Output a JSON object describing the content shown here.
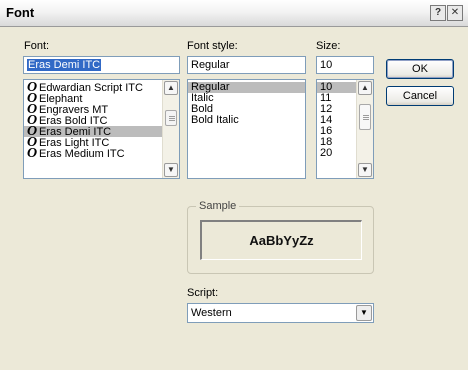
{
  "window": {
    "title": "Font",
    "help_glyph": "?",
    "close_glyph": "✕"
  },
  "font": {
    "label": "Font:",
    "value": "Eras Demi ITC",
    "items": [
      {
        "glyph": "O",
        "label": "Edwardian Script ITC"
      },
      {
        "glyph": "O",
        "label": "Elephant"
      },
      {
        "glyph": "O",
        "label": "Engravers MT"
      },
      {
        "glyph": "O",
        "label": "Eras Bold ITC"
      },
      {
        "glyph": "O",
        "label": "Eras Demi ITC"
      },
      {
        "glyph": "O",
        "label": "Eras Light ITC"
      },
      {
        "glyph": "O",
        "label": "Eras Medium ITC"
      }
    ],
    "selected_index": 4
  },
  "style": {
    "label": "Font style:",
    "value": "Regular",
    "items": [
      "Regular",
      "Italic",
      "Bold",
      "Bold Italic"
    ],
    "selected_index": 0
  },
  "size": {
    "label": "Size:",
    "value": "10",
    "items": [
      "10",
      "11",
      "12",
      "14",
      "16",
      "18",
      "20"
    ],
    "selected_index": 0
  },
  "buttons": {
    "ok": "OK",
    "cancel": "Cancel"
  },
  "sample": {
    "label": "Sample",
    "text": "AaBbYyZz"
  },
  "script": {
    "label": "Script:",
    "value": "Western"
  },
  "icons": {
    "scroll_up": "▲",
    "scroll_down": "▼",
    "combo_arrow": "▼"
  }
}
